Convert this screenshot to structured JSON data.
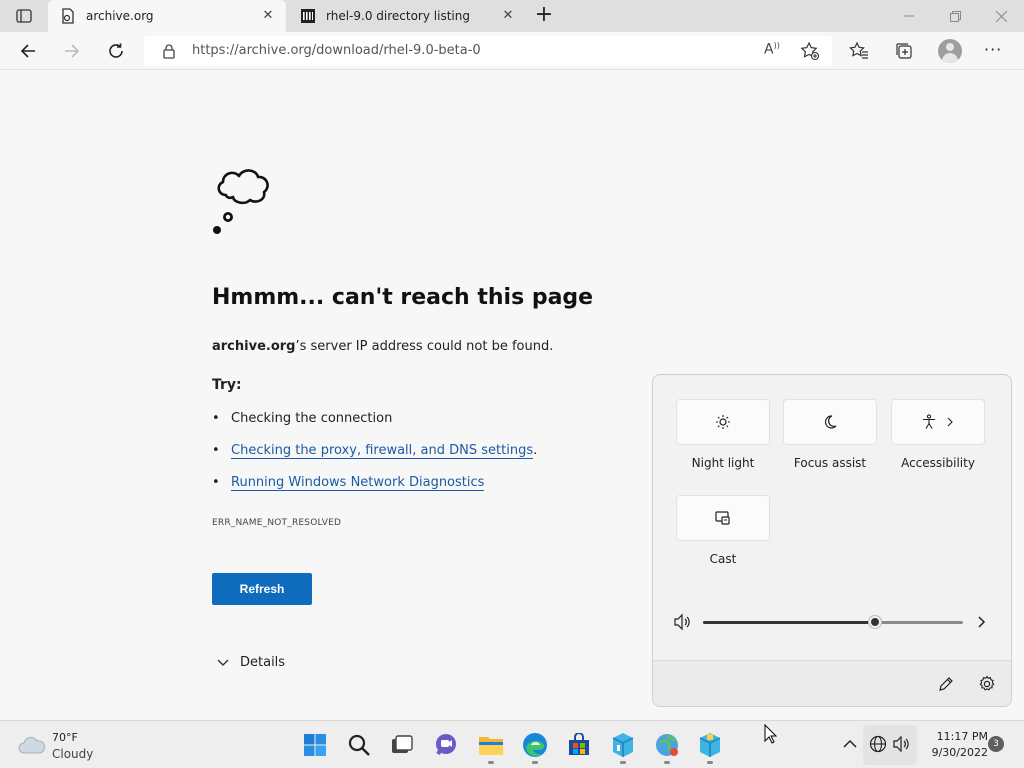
{
  "tabs": [
    {
      "title": "archive.org",
      "active": true
    },
    {
      "title": "rhel-9.0 directory listing",
      "active": false
    }
  ],
  "address_bar": {
    "url": "https://archive.org/download/rhel-9.0-beta-0"
  },
  "error_page": {
    "title": "Hmmm... can't reach this page",
    "host": "archive.org",
    "desc_rest": "’s server IP address could not be found.",
    "try_label": "Try:",
    "suggestions": [
      {
        "text": "Checking the connection",
        "link": false
      },
      {
        "text": "Checking the proxy, firewall, and DNS settings",
        "link": true,
        "suffix": "."
      },
      {
        "text": "Running Windows Network Diagnostics",
        "link": true
      }
    ],
    "error_code": "ERR_NAME_NOT_RESOLVED",
    "refresh_label": "Refresh",
    "details_label": "Details"
  },
  "quick_settings": {
    "tiles": [
      {
        "label": "Night light",
        "icon": "brightness-icon"
      },
      {
        "label": "Focus assist",
        "icon": "moon-icon"
      },
      {
        "label": "Accessibility",
        "icon": "accessibility-icon"
      },
      {
        "label": "Cast",
        "icon": "cast-icon"
      }
    ],
    "volume_level": 0.67
  },
  "taskbar": {
    "weather": {
      "temp": "70°F",
      "condition": "Cloudy"
    },
    "clock": {
      "time": "11:17 PM",
      "date": "9/30/2022"
    },
    "notifications": "3"
  }
}
